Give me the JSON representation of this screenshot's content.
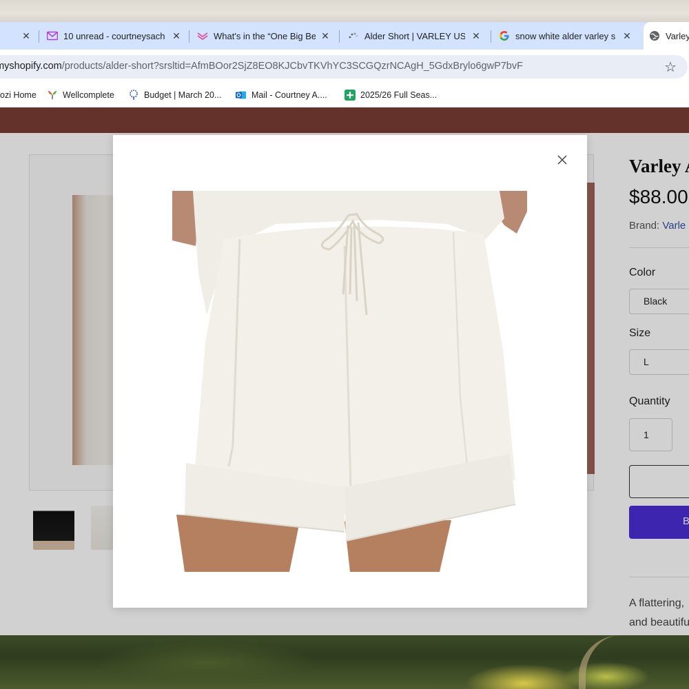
{
  "browser": {
    "tabs": [
      {
        "title": "",
        "icon": "close-icon"
      },
      {
        "title": "10 unread - courtneysach",
        "icon": "mail-icon"
      },
      {
        "title": "What's in the “One Big Be",
        "icon": "newsletter-icon"
      },
      {
        "title": "Alder Short | VARLEY US",
        "icon": "loading-icon"
      },
      {
        "title": "snow white alder varley s",
        "icon": "google-icon"
      },
      {
        "title": "Varley",
        "icon": "globe-icon"
      }
    ],
    "address": {
      "host": "e.myshopify.com",
      "path": "/products/alder-short?srsltid=AfmBOor2SjZ8EO8KJCbvTKVhYC3SCGQzrNCAgH_5GdxBrylo6gwP7bvF"
    },
    "bookmarks": [
      {
        "label": "ozi Home"
      },
      {
        "label": "Wellcomplete"
      },
      {
        "label": "Budget | March 20..."
      },
      {
        "label": "Mail - Courtney A...."
      },
      {
        "label": "2025/26 Full Seas..."
      }
    ]
  },
  "product": {
    "title": "Varley A",
    "price": "$88.00",
    "brand_label": "Brand: ",
    "brand_value": "Varle",
    "color_label": "Color",
    "color_value": "Black",
    "size_label": "Size",
    "size_value": "L",
    "quantity_label": "Quantity",
    "quantity_value": "1",
    "buy_label": "B",
    "description_line1": "A flattering,",
    "description_line2": "and beautifu"
  },
  "modal": {
    "image_subject": "white shorts with drawstring"
  },
  "colors": {
    "tabbar": "#d3e3fd",
    "announcement": "#7a3e34",
    "buy_button": "#4b2ed6",
    "link": "#3450a0"
  }
}
